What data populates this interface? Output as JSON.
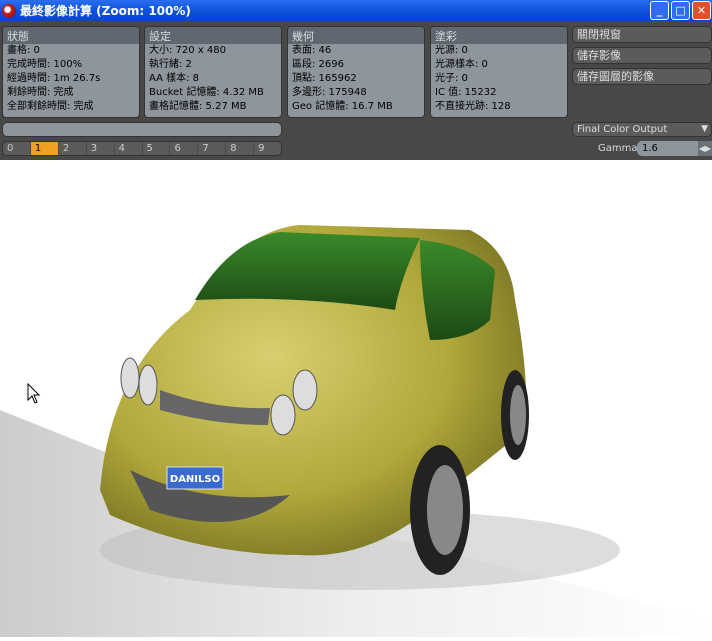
{
  "window": {
    "title": "最終影像計算 (Zoom: 100%)",
    "minimize": "_",
    "maximize": "□",
    "close": "✕"
  },
  "panels": [
    {
      "title": "狀態",
      "lines": [
        "畫格: 0",
        "完成時間: 100%",
        "經過時間: 1m 26.7s",
        "剩餘時間: 完成",
        "全部剩餘時間: 完成"
      ]
    },
    {
      "title": "設定",
      "lines": [
        "大小: 720 x 480",
        "執行緒: 2",
        "AA 樣本: 8",
        "Bucket 記憶體: 4.32 MB",
        "畫格記憶體: 5.27 MB"
      ]
    },
    {
      "title": "幾何",
      "lines": [
        "表面: 46",
        "區段: 2696",
        "頂點: 165962",
        "多邊形: 175948",
        "Geo 記憶體: 16.7 MB"
      ]
    },
    {
      "title": "塗彩",
      "lines": [
        "光源: 0",
        "光源樣本: 0",
        "光子: 0",
        "IC 值: 15232",
        "不直接光跡: 128"
      ]
    }
  ],
  "buttons": {
    "close_view": "關閉視窗",
    "save_image": "儲存影像",
    "save_layered": "儲存圖層的影像"
  },
  "frames": {
    "labels": [
      "0",
      "1",
      "2",
      "3",
      "4",
      "5",
      "6",
      "7",
      "8",
      "9"
    ],
    "selected": "1"
  },
  "progress": 0,
  "output": {
    "selected": "Final Color Output"
  },
  "gamma": {
    "label": "Gamma",
    "value": "1.6"
  },
  "render": {
    "plate": "DANILSO"
  },
  "colors": {
    "accent": "#f0a020",
    "car": "#b8b040"
  }
}
